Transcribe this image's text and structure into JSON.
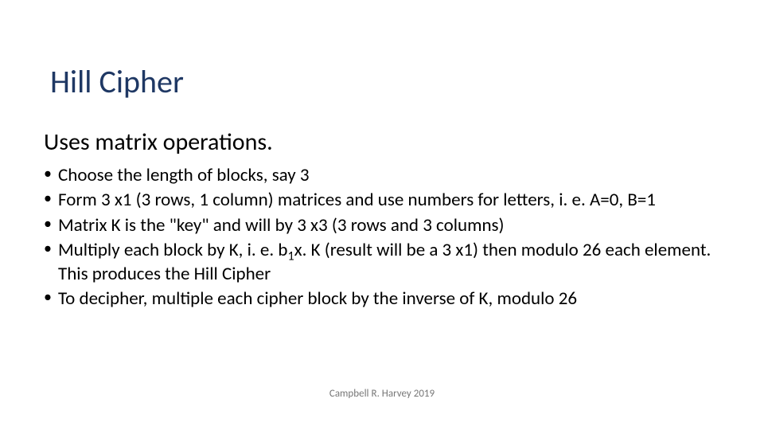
{
  "title": "Hill Cipher",
  "subtitle": "Uses matrix operations.",
  "bullets": {
    "b1": "Choose the length of blocks, say 3",
    "b2": "Form 3 x1 (3 rows, 1 column) matrices and use numbers for letters, i. e. A=0, B=1",
    "b3": "Matrix K is the \"key\" and will by 3 x3 (3 rows and 3 columns)",
    "b4a": "Multiply each block by K, i. e. b",
    "b4sub": "1",
    "b4b": "x. K (result will be a 3 x1) then modulo 26 each element. This produces the Hill Cipher",
    "b5": "To decipher, multiple each cipher block by the inverse of K, modulo 26"
  },
  "footer": "Campbell R. Harvey 2019"
}
